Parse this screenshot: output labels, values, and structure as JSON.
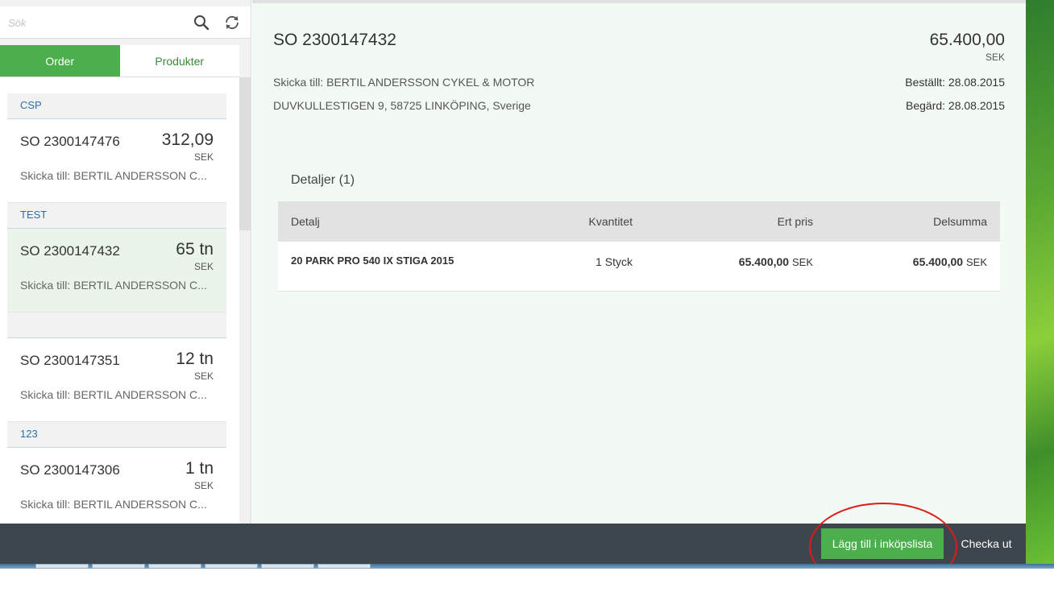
{
  "search": {
    "placeholder": "Sök"
  },
  "tabs": {
    "order": "Order",
    "products": "Produkter"
  },
  "list": {
    "groups": [
      "CSP",
      "TEST",
      "123"
    ],
    "items": [
      {
        "number": "SO 2300147476",
        "amount": "312,09",
        "currency": "SEK",
        "ship": "Skicka till: BERTIL ANDERSSON C..."
      },
      {
        "number": "SO 2300147432",
        "amount": "65 tn",
        "currency": "SEK",
        "ship": "Skicka till: BERTIL ANDERSSON C..."
      },
      {
        "number": "SO 2300147351",
        "amount": "12 tn",
        "currency": "SEK",
        "ship": "Skicka till: BERTIL ANDERSSON C..."
      },
      {
        "number": "SO 2300147306",
        "amount": "1 tn",
        "currency": "SEK",
        "ship": "Skicka till: BERTIL ANDERSSON C..."
      }
    ]
  },
  "detail": {
    "title": "SO 2300147432",
    "amount": "65.400,00",
    "currency": "SEK",
    "ship_to": "Skicka till: BERTIL ANDERSSON CYKEL & MOTOR",
    "address": "DUVKULLESTIGEN 9, 58725 LINKÖPING, Sverige",
    "ordered": "Beställt: 28.08.2015",
    "requested": "Begärd: 28.08.2015",
    "section_title": "Detaljer (1)",
    "columns": {
      "detail": "Detalj",
      "quantity": "Kvantitet",
      "price": "Ert pris",
      "subtotal": "Delsumma"
    },
    "row": {
      "name": "20 PARK PRO 540 IX STIGA 2015",
      "quantity": "1 Styck",
      "price": "65.400,00",
      "price_currency": "SEK",
      "subtotal": "65.400,00",
      "subtotal_currency": "SEK"
    }
  },
  "footer": {
    "add_to_list": "Lägg till i inköpslista",
    "checkout": "Checka ut"
  },
  "colors": {
    "accent": "#4cae4c",
    "footer": "#3d464c",
    "annotation": "#e01a1a"
  }
}
